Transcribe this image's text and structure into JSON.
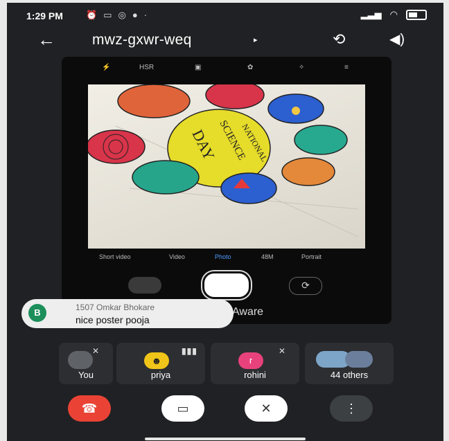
{
  "status_bar": {
    "time": "1:29 PM",
    "left_icons": [
      "alarm-icon",
      "video-record-icon",
      "instagram-icon",
      "location-icon",
      "dot"
    ],
    "right_icons": [
      "signal-icon",
      "wifi-icon",
      "battery-icon"
    ]
  },
  "header": {
    "meeting_code": "mwz-gxwr-weq",
    "expand_glyph": "▸"
  },
  "shared_screen": {
    "camera_toolbar": [
      "HSR"
    ],
    "camera_modes": [
      "Short video",
      "Video",
      "Photo",
      "48M",
      "Portrait"
    ],
    "active_mode": "Photo",
    "poster_text": [
      "NATIONAL",
      "SCIENCE",
      "DAY"
    ],
    "overlay_text": "Aware"
  },
  "chat_toast": {
    "avatar_letter": "B",
    "sender": "1507 Omkar Bhokare",
    "message": "nice poster pooja"
  },
  "participants": [
    {
      "label": "You"
    },
    {
      "label": "priya"
    },
    {
      "label": "rohini",
      "avatar_letter": "r"
    },
    {
      "label": "44 others"
    }
  ],
  "controls": {
    "end_call_color": "#ea4335",
    "camera_off_color": "#ffffff",
    "mic_off_color": "#ffffff"
  }
}
